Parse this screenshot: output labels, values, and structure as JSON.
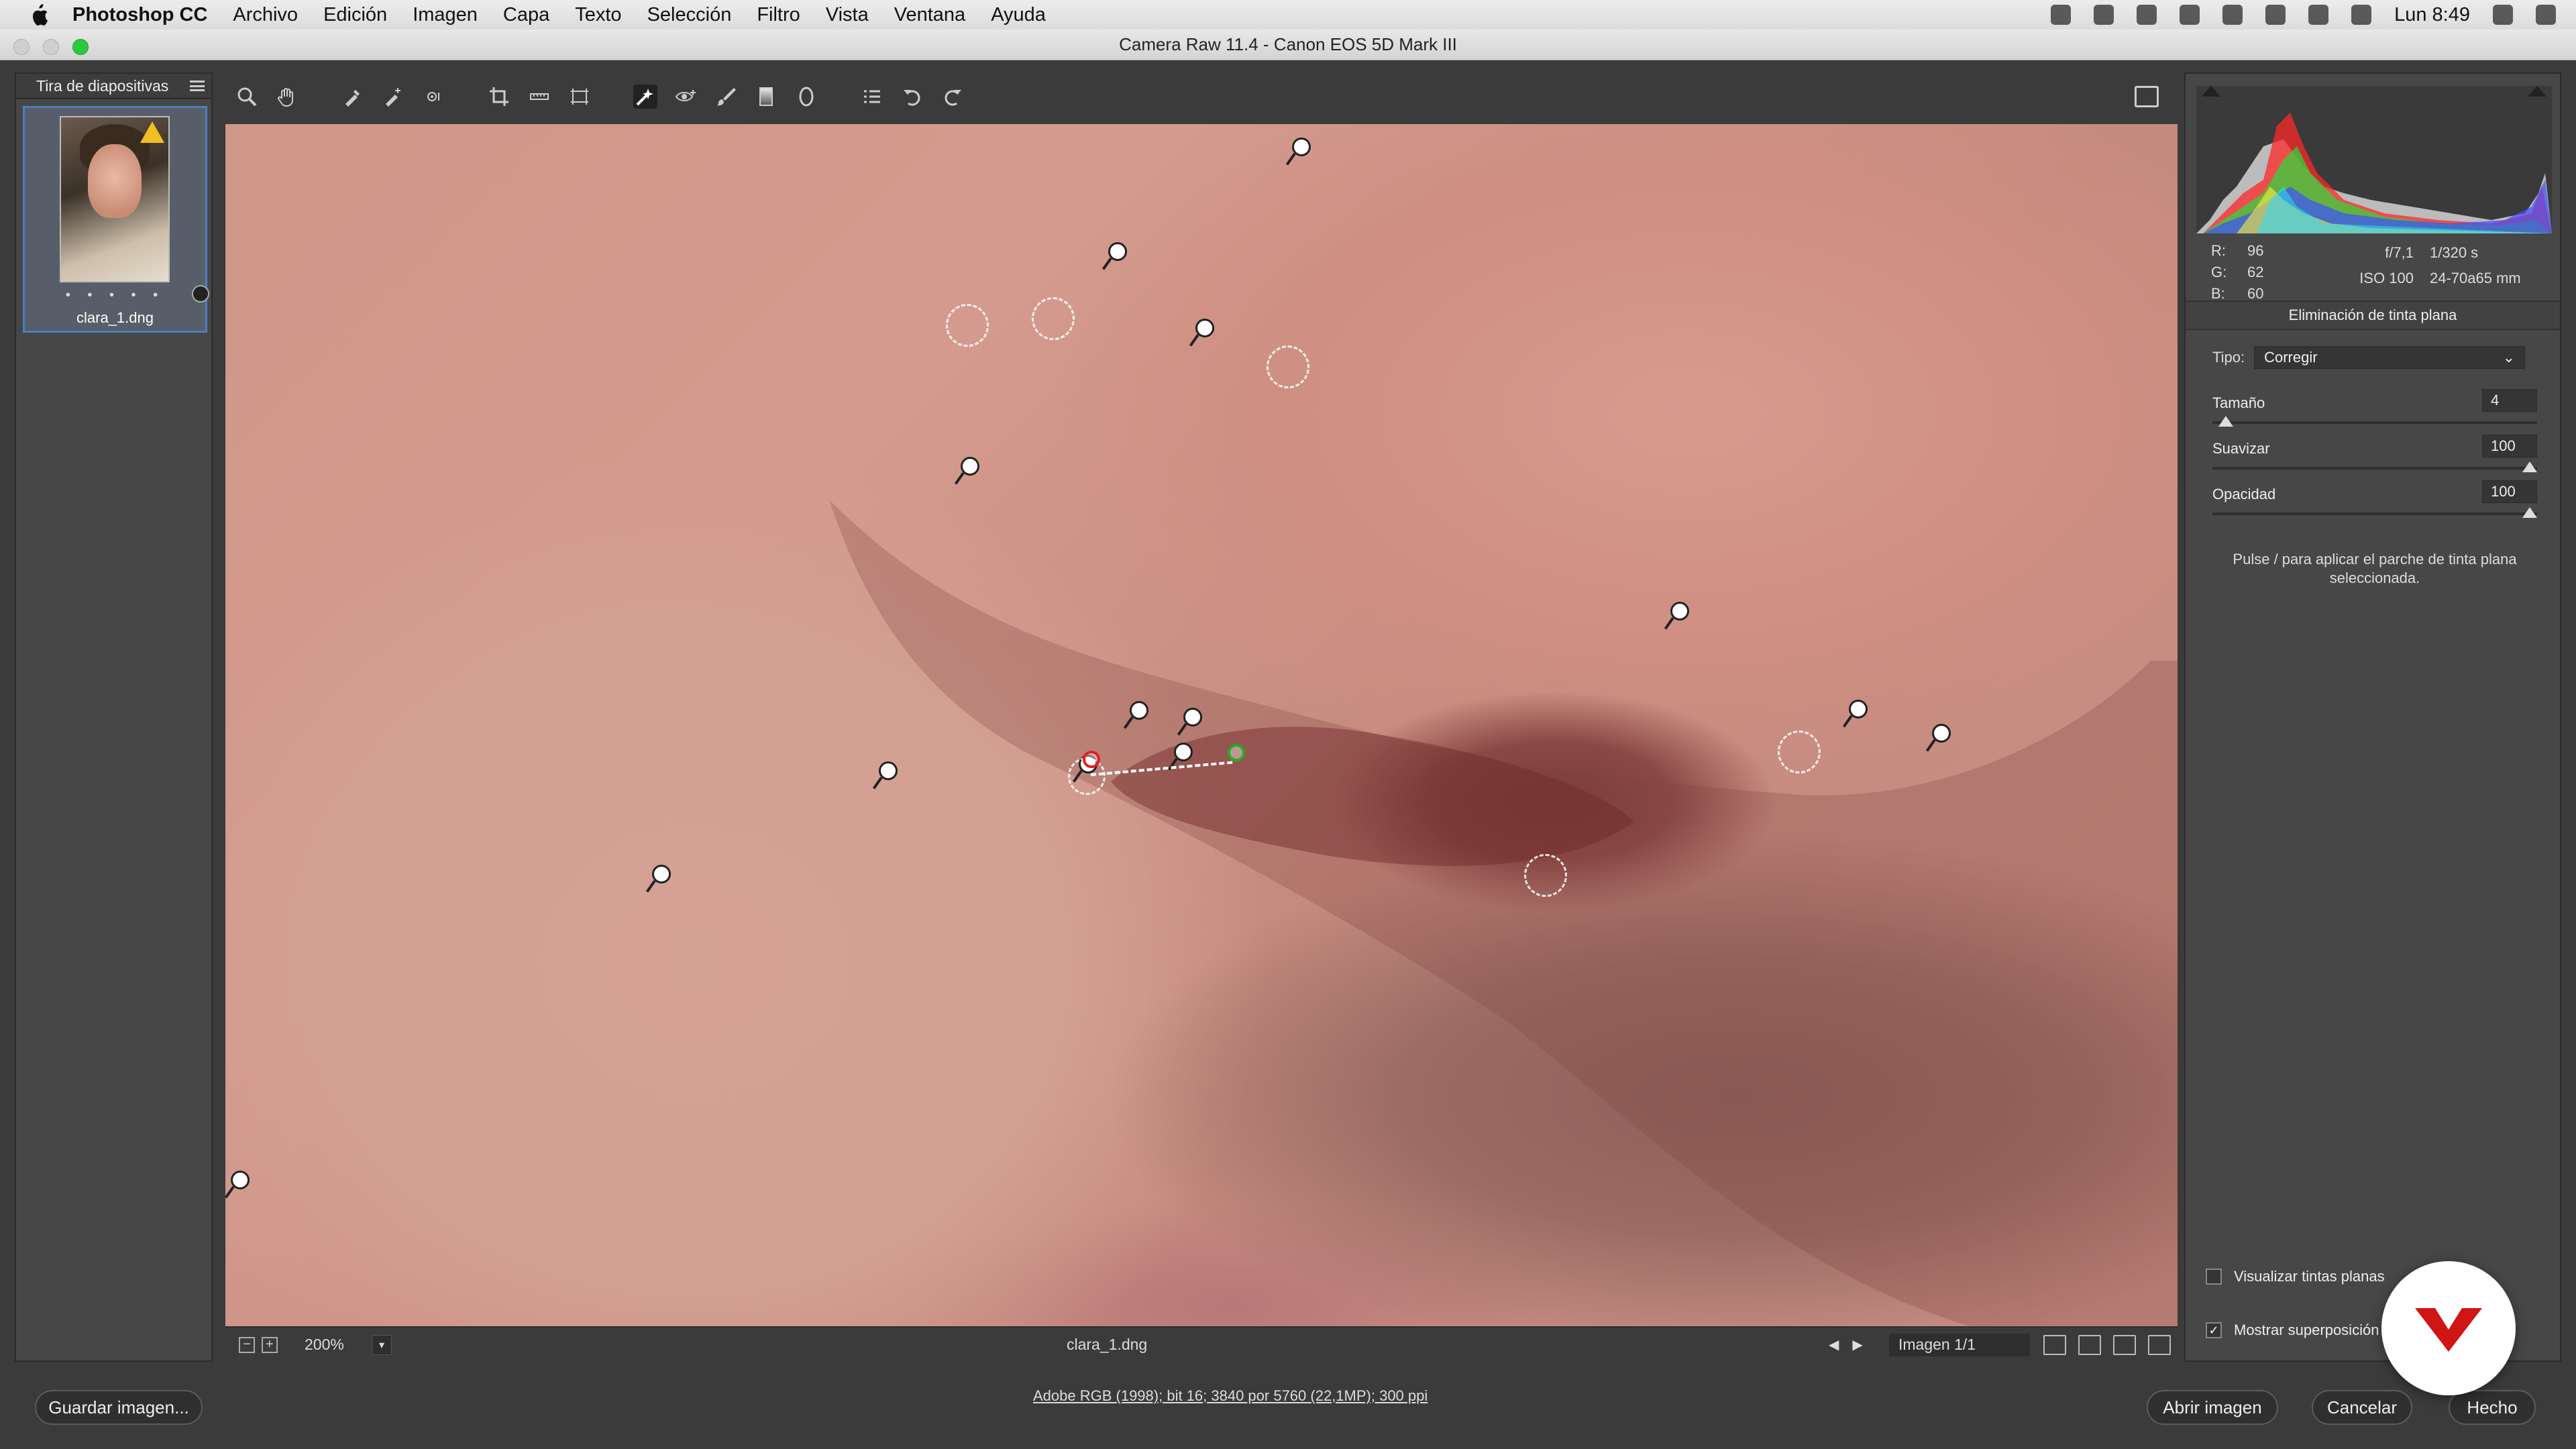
{
  "menubar": {
    "app_name": "Photoshop CC",
    "items": [
      "Archivo",
      "Edición",
      "Imagen",
      "Capa",
      "Texto",
      "Selección",
      "Filtro",
      "Vista",
      "Ventana",
      "Ayuda"
    ],
    "clock": "Lun 8:49"
  },
  "window": {
    "title": "Camera Raw 11.4 -  Canon EOS 5D Mark III"
  },
  "filmstrip": {
    "header": "Tira de diapositivas",
    "thumb_name": "clara_1.dng",
    "rating_dots": "• • • • •"
  },
  "statusbar": {
    "zoom": "200%",
    "filename": "clara_1.dng",
    "image_count": "Imagen 1/1"
  },
  "info": {
    "r_label": "R:",
    "r_value": "96",
    "g_label": "G:",
    "g_value": "62",
    "b_label": "B:",
    "b_value": "60",
    "aperture": "f/7,1",
    "shutter": "1/320 s",
    "iso": "ISO 100",
    "lens": "24-70a65 mm"
  },
  "panel": {
    "title": "Eliminación de tinta plana",
    "type_label": "Tipo:",
    "type_value": "Corregir",
    "size_label": "Tamaño",
    "size_value": "4",
    "size_level": 0.02,
    "feather_label": "Suavizar",
    "feather_value": "100",
    "feather_level": 1.0,
    "opacity_label": "Opacidad",
    "opacity_value": "100",
    "opacity_level": 1.0,
    "hint": "Pulse / para aplicar el parche de tinta plana seleccionada.",
    "visualize_label": "Visualizar tintas planas",
    "visualize_checked": false,
    "overlay_label": "Mostrar superposición",
    "overlay_checked": true
  },
  "bottombar": {
    "save_label": "Guardar imagen...",
    "workflow": "Adobe RGB (1998); bit 16; 3840 por 5760 (22,1MP); 300 ppi",
    "open_label": "Abrir imagen",
    "cancel_label": "Cancelar",
    "done_label": "Hecho"
  },
  "colors": {
    "selection_blue": "#4a7fc1",
    "source_red": "#e02020",
    "target_green": "#20b020",
    "brand_red": "#d01515"
  }
}
